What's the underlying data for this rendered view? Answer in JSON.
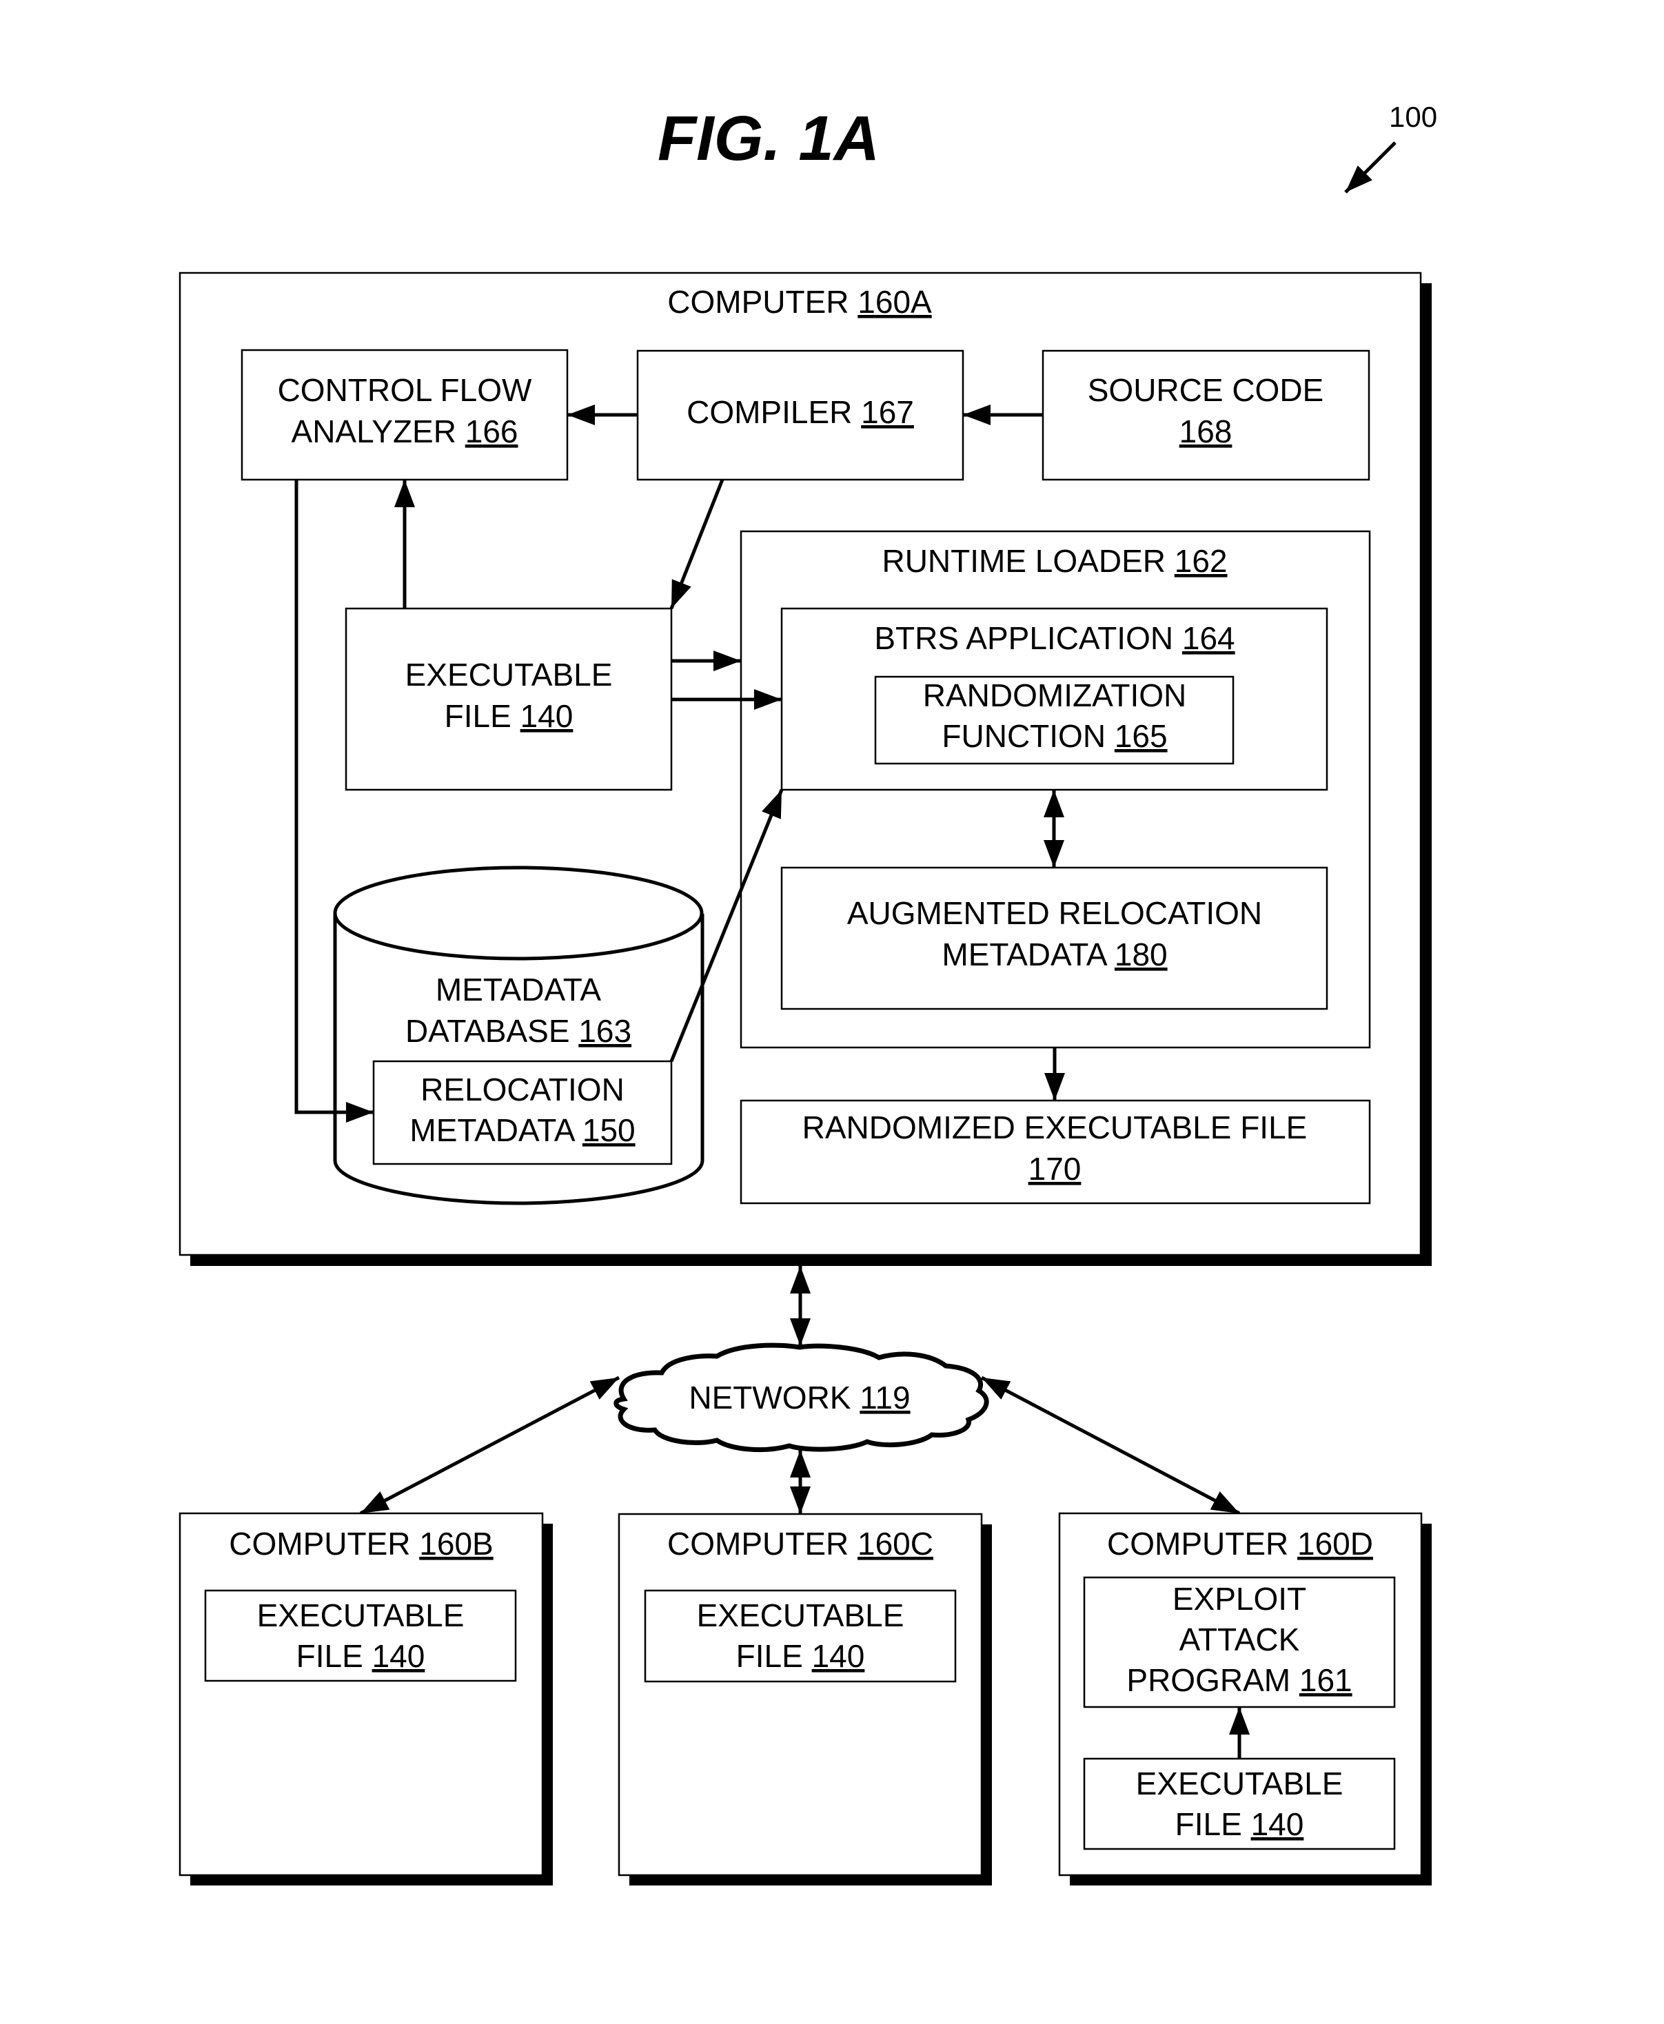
{
  "figure": {
    "title": "FIG. 1A",
    "reference": "100"
  },
  "computer_a": {
    "label": "COMPUTER ",
    "ref": "160A",
    "control_flow_analyzer": {
      "line1": "CONTROL FLOW",
      "line2": "ANALYZER ",
      "ref": "166"
    },
    "compiler": {
      "line1": "COMPILER ",
      "ref": "167"
    },
    "source_code": {
      "line1": "SOURCE CODE",
      "ref": "168"
    },
    "executable_file": {
      "line1": "EXECUTABLE",
      "line2": "FILE ",
      "ref": "140"
    },
    "runtime_loader": {
      "label": "RUNTIME LOADER ",
      "ref": "162",
      "btrs_application": {
        "label": "BTRS APPLICATION ",
        "ref": "164"
      },
      "randomization_function": {
        "line1": "RANDOMIZATION",
        "line2": "FUNCTION ",
        "ref": "165"
      },
      "augmented_relocation_metadata": {
        "line1": "AUGMENTED RELOCATION",
        "line2": "METADATA ",
        "ref": "180"
      }
    },
    "metadata_database": {
      "line1": "METADATA",
      "line2": "DATABASE ",
      "ref": "163"
    },
    "relocation_metadata": {
      "line1": "RELOCATION",
      "line2": "METADATA ",
      "ref": "150"
    },
    "randomized_executable_file": {
      "line1": "RANDOMIZED EXECUTABLE FILE",
      "ref": "170"
    }
  },
  "network": {
    "label": "NETWORK ",
    "ref": "119"
  },
  "computer_b": {
    "label": "COMPUTER ",
    "ref": "160B",
    "executable_file": {
      "line1": "EXECUTABLE",
      "line2": "FILE ",
      "ref": "140"
    }
  },
  "computer_c": {
    "label": "COMPUTER ",
    "ref": "160C",
    "executable_file": {
      "line1": "EXECUTABLE",
      "line2": "FILE ",
      "ref": "140"
    }
  },
  "computer_d": {
    "label": "COMPUTER ",
    "ref": "160D",
    "exploit_attack_program": {
      "line1": "EXPLOIT",
      "line2": "ATTACK",
      "line3": "PROGRAM ",
      "ref": "161"
    },
    "executable_file": {
      "line1": "EXECUTABLE",
      "line2": "FILE ",
      "ref": "140"
    }
  }
}
